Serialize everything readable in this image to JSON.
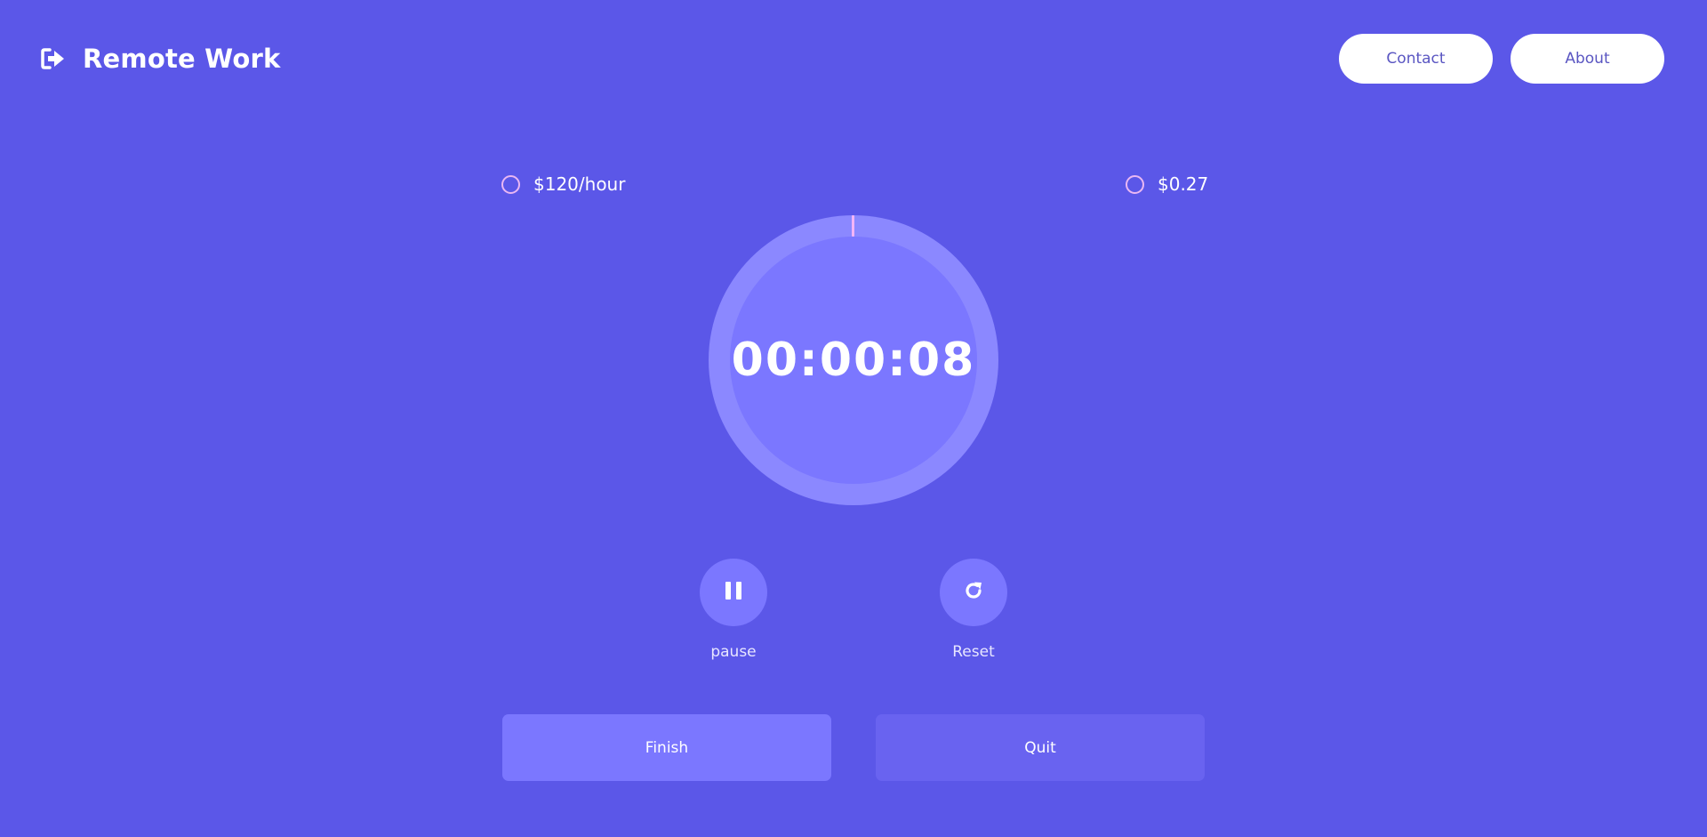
{
  "header": {
    "title": "Remote Work",
    "logo_icon": "sign-out-icon",
    "nav": {
      "contact_label": "Contact",
      "about_label": "About"
    }
  },
  "rate": {
    "hourly_label": "$120/hour",
    "earned_label": "$0.27"
  },
  "timer": {
    "display": "00:00:08",
    "progress": 0.002
  },
  "controls": {
    "pause": {
      "label": "pause",
      "icon": "pause-icon"
    },
    "reset": {
      "label": "Reset",
      "icon": "redo-icon"
    }
  },
  "actions": {
    "finish_label": "Finish",
    "quit_label": "Quit"
  },
  "colors": {
    "background": "#5b57e8",
    "accent_light": "#7b77ff",
    "ring": "#8b88ff",
    "radio_border": "#e9b7f3",
    "nav_text": "#5a56c2"
  }
}
